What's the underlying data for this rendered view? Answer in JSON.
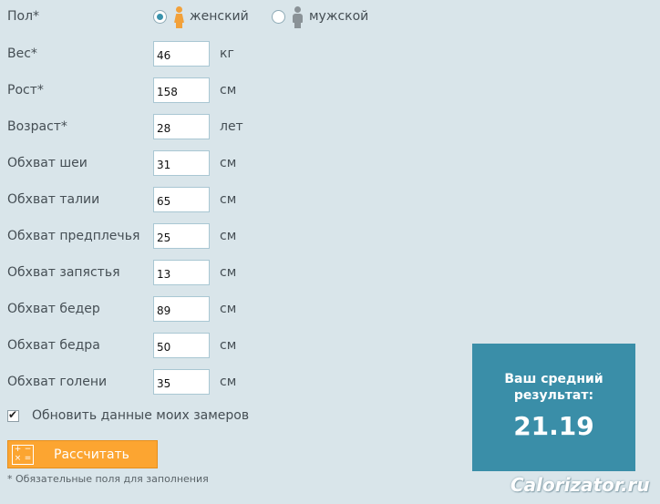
{
  "gender": {
    "label": "Пол*",
    "female_label": "женский",
    "male_label": "мужской",
    "selected": "female"
  },
  "fields": [
    {
      "label": "Вес*",
      "value": "46",
      "unit": "кг"
    },
    {
      "label": "Рост*",
      "value": "158",
      "unit": "см"
    },
    {
      "label": "Возраст*",
      "value": "28",
      "unit": "лет"
    },
    {
      "label": "Обхват шеи",
      "value": "31",
      "unit": "см"
    },
    {
      "label": "Обхват талии",
      "value": "65",
      "unit": "см"
    },
    {
      "label": "Обхват предплечья",
      "value": "25",
      "unit": "см"
    },
    {
      "label": "Обхват запястья",
      "value": "13",
      "unit": "см"
    },
    {
      "label": "Обхват бедер",
      "value": "89",
      "unit": "см"
    },
    {
      "label": "Обхват бедра",
      "value": "50",
      "unit": "см"
    },
    {
      "label": "Обхват голени",
      "value": "35",
      "unit": "см"
    }
  ],
  "update_checkbox": {
    "label": "Обновить данные моих замеров",
    "checked": true
  },
  "calc_button": {
    "label": "Рассчитать",
    "icon_glyphs": [
      "+",
      "−",
      "×",
      "="
    ]
  },
  "footnote": "* Обязательные поля для заполнения",
  "result": {
    "title_line1": "Ваш средний",
    "title_line2": "результат:",
    "value": "21.19"
  },
  "watermark": "Calorizator.ru",
  "colors": {
    "background": "#d9e5ea",
    "result_bg": "#3a8ea8",
    "button_bg": "#fca531",
    "female_icon": "#f2a13a",
    "male_icon": "#8a9297"
  }
}
